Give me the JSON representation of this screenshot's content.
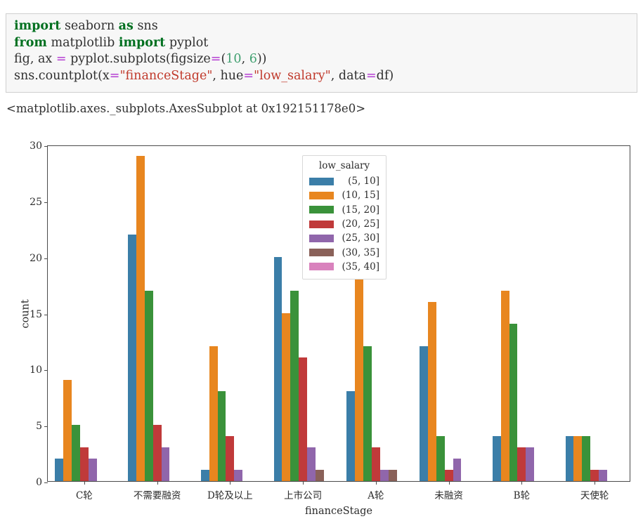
{
  "code_cell": {
    "lines": [
      [
        {
          "t": "import",
          "c": "kw"
        },
        {
          "t": " seaborn ",
          "c": "plain"
        },
        {
          "t": "as",
          "c": "kw"
        },
        {
          "t": " sns",
          "c": "plain"
        }
      ],
      [
        {
          "t": "from",
          "c": "kw"
        },
        {
          "t": " matplotlib ",
          "c": "plain"
        },
        {
          "t": "import",
          "c": "kw"
        },
        {
          "t": " pyplot",
          "c": "plain"
        }
      ],
      [
        {
          "t": "fig, ax ",
          "c": "plain"
        },
        {
          "t": "=",
          "c": "op"
        },
        {
          "t": " pyplot.subplots(figsize",
          "c": "plain"
        },
        {
          "t": "=",
          "c": "op"
        },
        {
          "t": "(",
          "c": "plain"
        },
        {
          "t": "10",
          "c": "num"
        },
        {
          "t": ", ",
          "c": "plain"
        },
        {
          "t": "6",
          "c": "num"
        },
        {
          "t": "))",
          "c": "plain"
        }
      ],
      [
        {
          "t": "sns.countplot(x",
          "c": "plain"
        },
        {
          "t": "=",
          "c": "op"
        },
        {
          "t": "\"financeStage\"",
          "c": "str"
        },
        {
          "t": ", hue",
          "c": "plain"
        },
        {
          "t": "=",
          "c": "op"
        },
        {
          "t": "\"low_salary\"",
          "c": "str"
        },
        {
          "t": ", data",
          "c": "plain"
        },
        {
          "t": "=",
          "c": "op"
        },
        {
          "t": "df)",
          "c": "plain"
        }
      ]
    ]
  },
  "output_repr": "<matplotlib.axes._subplots.AxesSubplot at 0x192151178e0>",
  "chart_data": {
    "type": "bar",
    "title": "",
    "xlabel": "financeStage",
    "ylabel": "count",
    "ylim": [
      0,
      30
    ],
    "yticks": [
      0,
      5,
      10,
      15,
      20,
      25,
      30
    ],
    "grid": false,
    "legend_position": "upper center",
    "legend_title": "low_salary",
    "categories": [
      "C轮",
      "不需要融资",
      "D轮及以上",
      "上市公司",
      "A轮",
      "未融资",
      "B轮",
      "天使轮"
    ],
    "series": [
      {
        "name": "(5, 10]",
        "color": "#3b7ea8",
        "values": [
          2,
          22,
          1,
          20,
          8,
          12,
          4,
          4
        ]
      },
      {
        "name": "(10, 15]",
        "color": "#e8861f",
        "values": [
          9,
          29,
          12,
          15,
          29,
          16,
          17,
          4
        ]
      },
      {
        "name": "(15, 20]",
        "color": "#3a923a",
        "values": [
          5,
          17,
          8,
          17,
          12,
          4,
          14,
          4
        ]
      },
      {
        "name": "(20, 25]",
        "color": "#c03a3a",
        "values": [
          3,
          5,
          4,
          11,
          3,
          1,
          3,
          1
        ]
      },
      {
        "name": "(25, 30]",
        "color": "#9066ab",
        "values": [
          2,
          3,
          1,
          3,
          1,
          2,
          3,
          1
        ]
      },
      {
        "name": "(30, 35]",
        "color": "#8a6159",
        "values": [
          0,
          0,
          0,
          1,
          1,
          0,
          0,
          0
        ]
      },
      {
        "name": "(35, 40]",
        "color": "#d982bd",
        "values": [
          0,
          0,
          0,
          0,
          0,
          0,
          0,
          0
        ]
      }
    ]
  }
}
